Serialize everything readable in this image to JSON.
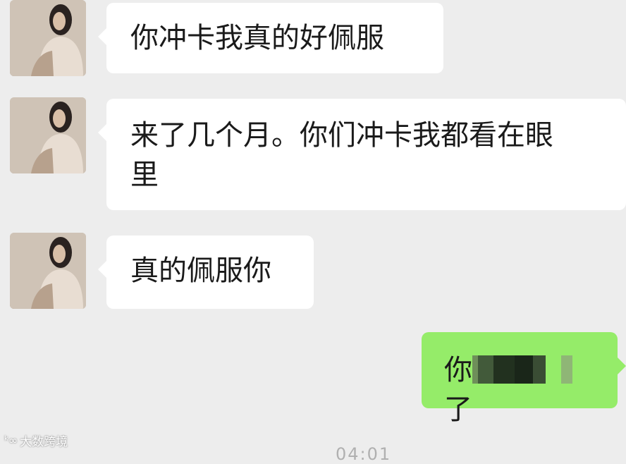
{
  "messages": [
    {
      "sender": "other",
      "text": "你冲卡我真的好佩服"
    },
    {
      "sender": "other",
      "text_line1": "来了几个月。你们冲卡我都看在眼",
      "text_line2": "里"
    },
    {
      "sender": "other",
      "text": "真的佩服你"
    },
    {
      "sender": "self",
      "text_start": "你",
      "text_end": "了",
      "redacted": true
    }
  ],
  "colors": {
    "background": "#ededed",
    "incoming_bubble": "#ffffff",
    "outgoing_bubble": "#95ec69"
  },
  "watermark": {
    "logo": "ᵏ∞",
    "text": "大数跨境"
  },
  "timestamp": "04:01"
}
